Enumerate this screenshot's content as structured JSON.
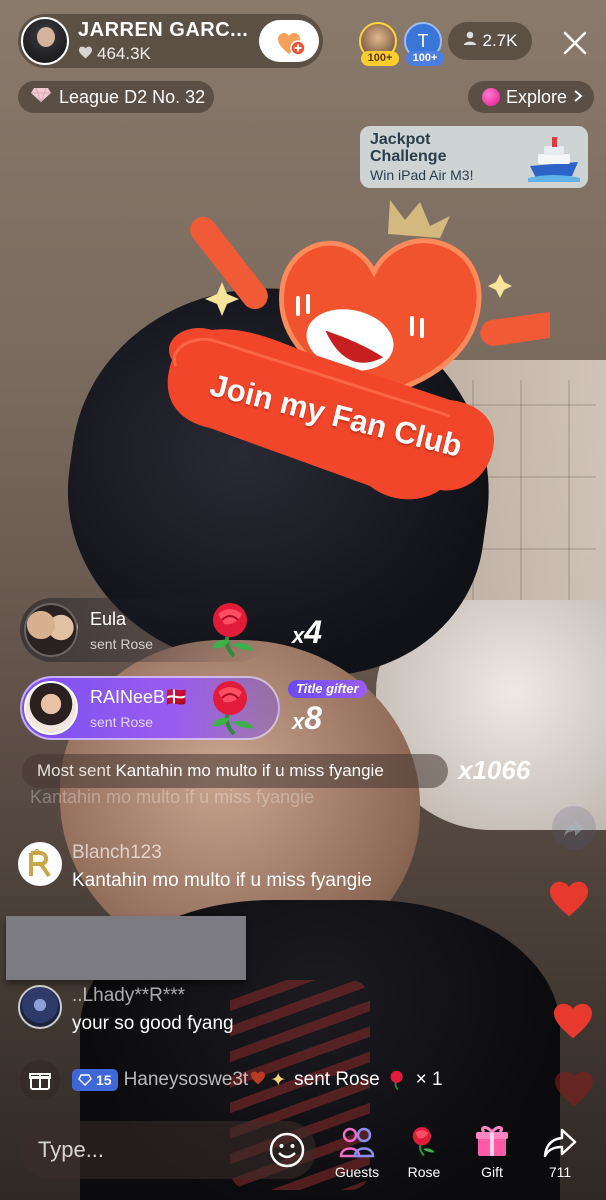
{
  "host": {
    "name": "JARREN GARC...",
    "likes": "464.3K"
  },
  "viewers": {
    "badge1": "100+",
    "badge2": "100+",
    "avatar2_letter": "T",
    "count": "2.7K"
  },
  "league": "League D2 No. 32",
  "explore": "Explore",
  "jackpot": {
    "title": "Jackpot Challenge",
    "subtitle": "Win iPad Air M3!"
  },
  "fan_club": {
    "label": "Join my Fan Club"
  },
  "gifts": [
    {
      "user": "Eula",
      "action": "sent Rose",
      "count": "4"
    },
    {
      "user": "RAINeeB🇩🇰",
      "action": "sent Rose",
      "count": "8",
      "tag": "Title gifter"
    }
  ],
  "count_prefix": "x",
  "most_sent": {
    "prefix": "Most sent",
    "text": "Kantahin mo multo if u miss fyangie",
    "count": "x1066"
  },
  "ghost_comment": "Kantahin mo multo if u miss fyangie",
  "comments": [
    {
      "user": "Blanch123",
      "text": "Kantahin mo multo if u miss fyangie"
    },
    {
      "user": "..Lhady**R***",
      "text": "your so good fyang"
    }
  ],
  "ticker": {
    "level": "15",
    "user": "Haneysoswe3t",
    "message": "sent Rose",
    "count": "× 1"
  },
  "composer": {
    "placeholder": "Type..."
  },
  "actions": [
    {
      "label": "Guests",
      "icon": "guests-icon"
    },
    {
      "label": "Rose",
      "icon": "rose-icon"
    },
    {
      "label": "Gift",
      "icon": "gift-icon"
    },
    {
      "label": "711",
      "icon": "share-icon"
    }
  ],
  "colors": {
    "fan_red": "#f0533a",
    "accent_blue": "#3e68d8",
    "like_red": "#e8392f"
  }
}
